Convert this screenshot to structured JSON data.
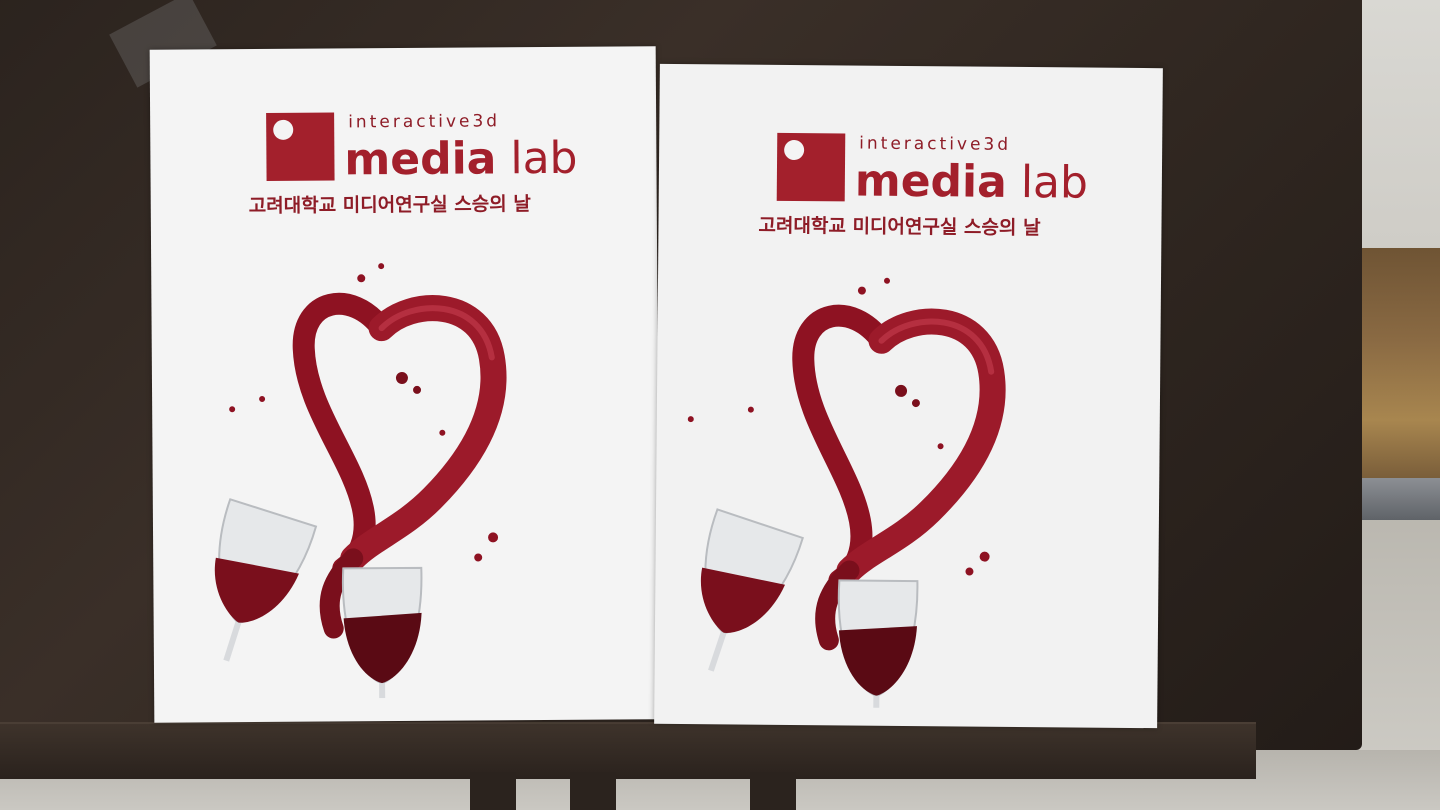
{
  "image": {
    "description_free": true,
    "posters": [
      {
        "logo": {
          "sub": "interactive3d",
          "main_bold": "media",
          "main_light": "lab"
        },
        "subtitle": "고려대학교 미디어연구실 스승의 날",
        "art_icon": "wine-heart-splash-icon"
      },
      {
        "logo": {
          "sub": "interactive3d",
          "main_bold": "media",
          "main_light": "lab"
        },
        "subtitle": "고려대학교 미디어연구실 스승의 날",
        "art_icon": "wine-heart-splash-icon"
      }
    ],
    "colors": {
      "brand_red": "#a3202c",
      "wine": "#7a0f1c",
      "board": "#2f2620",
      "paper": "#f4f4f4"
    }
  }
}
